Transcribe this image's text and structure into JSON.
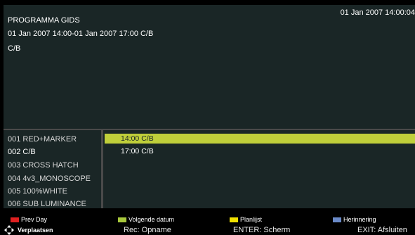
{
  "header": {
    "title": "PROGRAMMA GIDS",
    "clock": "01 Jan 2007 14:00:04",
    "time_range": "01 Jan 2007 14:00-01 Jan 2007 17:00 C/B",
    "program": "C/B"
  },
  "channels": [
    {
      "label": "001 RED+MARKER"
    },
    {
      "label": "002 C/B"
    },
    {
      "label": "003 CROSS HATCH"
    },
    {
      "label": "004 4v3_MONOSCOPE"
    },
    {
      "label": "005 100%WHITE"
    },
    {
      "label": "006 SUB LUMINANCE"
    }
  ],
  "events": [
    {
      "label": "14:00 C/B"
    },
    {
      "label": "17:00 C/B"
    }
  ],
  "footer": {
    "legend": [
      {
        "label": "Prev Day",
        "color": "#e02020"
      },
      {
        "label": "Volgende datum",
        "color": "#a8c83c"
      },
      {
        "label": "Planlijst",
        "color": "#f0e000"
      },
      {
        "label": "Herinnering",
        "color": "#6a8ac8"
      }
    ],
    "move_label": "Verplaatsen",
    "move_icon": "dpad-arrows-icon",
    "rec": "Rec: Opname",
    "enter": "ENTER: Scherm",
    "exit": "EXIT: Afsluiten"
  },
  "colors": {
    "panel": "#1a2626",
    "highlight": "#c0cf3a",
    "divider": "#4a4a4a"
  }
}
